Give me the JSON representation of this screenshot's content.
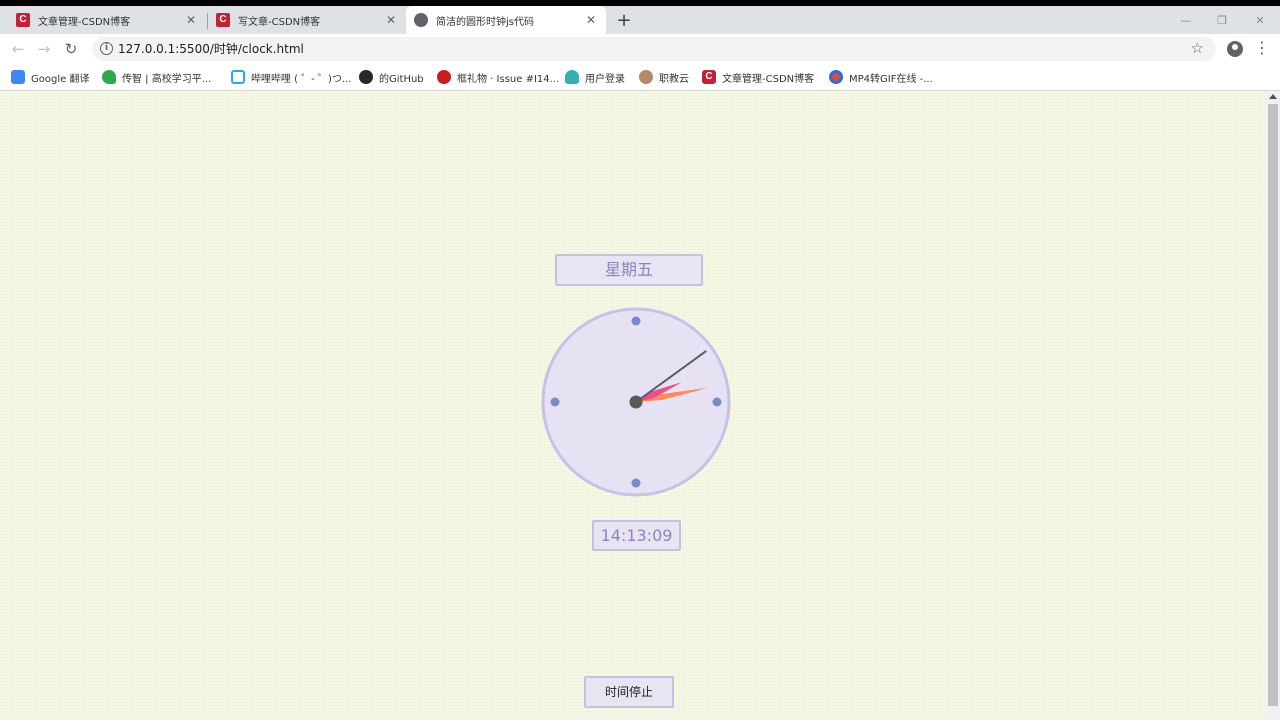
{
  "browser": {
    "tabs": [
      {
        "title": "文章管理-CSDN博客",
        "active": false
      },
      {
        "title": "写文章-CSDN博客",
        "active": false
      },
      {
        "title": "简洁的圆形时钟js代码",
        "active": true
      }
    ],
    "url": "127.0.0.1:5500/时钟/clock.html",
    "bookmarks": [
      "Google 翻译",
      "传智 | 高校学习平...",
      "哔哩哔哩 ( ゜- ゜)つ...",
      "的GitHub",
      "框礼物 · Issue #I14...",
      "用户登录",
      "职教云",
      "文章管理-CSDN博客",
      "MP4转GIF在线 -..."
    ]
  },
  "clock": {
    "weekday": "星期五",
    "time": "14:13:09",
    "hour": 14,
    "minute": 13,
    "second": 9,
    "colors": {
      "face": "#e6e2f3",
      "border": "#c8c0e6",
      "dots": "#7e88c8",
      "hour_hand": "#ee4d8a",
      "minute_hand": "#ff8a5c",
      "second_hand": "#5b5b66",
      "center": "#5a5a5a"
    }
  },
  "controls": {
    "stop_label": "时间停止"
  }
}
